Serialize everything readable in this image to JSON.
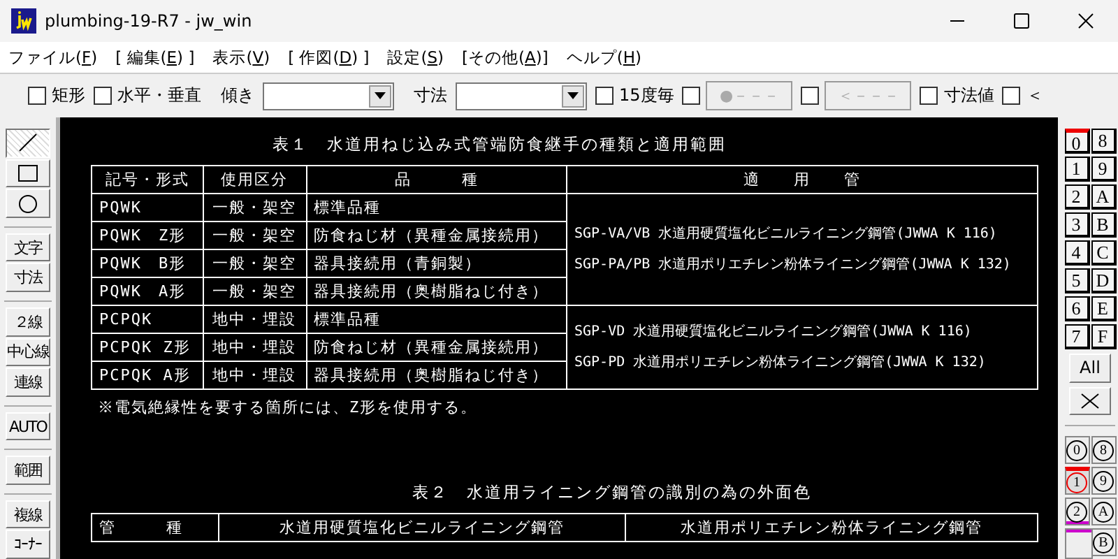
{
  "window": {
    "title": "plumbing-19-R7 - jw_win"
  },
  "menu": [
    {
      "before": "ファイル(",
      "key": "F",
      "after": ")"
    },
    {
      "before": "[ 編集(",
      "key": "E",
      "after": ") ]"
    },
    {
      "before": "表示(",
      "key": "V",
      "after": ")"
    },
    {
      "before": "[ 作図(",
      "key": "D",
      "after": ") ]"
    },
    {
      "before": "設定(",
      "key": "S",
      "after": ")"
    },
    {
      "before": "[その他(",
      "key": "A",
      "after": ")]"
    },
    {
      "before": "ヘルプ(",
      "key": "H",
      "after": ")"
    }
  ],
  "toolbar": [
    {
      "kind": "checkbox",
      "label": "矩形",
      "checked": false
    },
    {
      "kind": "checkbox",
      "label": "水平・垂直",
      "checked": false
    },
    {
      "kind": "label",
      "label": "傾き"
    },
    {
      "kind": "combo"
    },
    {
      "kind": "label",
      "label": "寸法"
    },
    {
      "kind": "combo"
    },
    {
      "kind": "checkbox",
      "label": "15度毎",
      "checked": false
    },
    {
      "kind": "check-button",
      "label": "●－－－",
      "checked": false
    },
    {
      "kind": "check-button",
      "label": "＜－－－",
      "checked": false
    },
    {
      "kind": "checkbox",
      "label": "寸法値",
      "checked": false
    },
    {
      "kind": "checkbox",
      "label": "＜",
      "checked": false
    }
  ],
  "tool_groups": [
    [
      {
        "kind": "line",
        "selected": true
      },
      {
        "kind": "rect",
        "selected": false
      },
      {
        "kind": "circle",
        "selected": false
      }
    ],
    [
      {
        "kind": "text",
        "label": "文字",
        "selected": false
      },
      {
        "kind": "text",
        "label": "寸法",
        "selected": false
      }
    ],
    [
      {
        "kind": "text",
        "label": "２線",
        "selected": false
      },
      {
        "kind": "text",
        "label": "中心線",
        "selected": false
      },
      {
        "kind": "text",
        "label": "連線",
        "selected": false
      }
    ],
    [
      {
        "kind": "text",
        "label": "AUTO",
        "selected": false
      }
    ],
    [
      {
        "kind": "text",
        "label": "範囲",
        "selected": false
      }
    ],
    [
      {
        "kind": "text",
        "label": "複線",
        "selected": false
      },
      {
        "kind": "text",
        "label": "ｺｰﾅｰ",
        "selected": false
      }
    ]
  ],
  "table1": {
    "title": "表１　水道用ねじ込み式管端防食継手の種類と適用範囲",
    "headers": [
      "記号・形式",
      "使用区分",
      "品　　　種",
      "適　　用　　管"
    ],
    "groups": [
      {
        "applicable": [
          "SGP-VA/VB 水道用硬質塩化ビニルライニング鋼管(JWWA K 116)",
          "SGP-PA/PB 水道用ポリエチレン粉体ライニング鋼管(JWWA K 132)"
        ],
        "rows": [
          [
            "PQWK",
            "一般・架空",
            "標準品種"
          ],
          [
            "PQWK　Z形",
            "一般・架空",
            "防食ねじ材（異種金属接続用）"
          ],
          [
            "PQWK　B形",
            "一般・架空",
            "器具接続用（青銅製）"
          ],
          [
            "PQWK　A形",
            "一般・架空",
            "器具接続用（奥樹脂ねじ付き）"
          ]
        ]
      },
      {
        "applicable": [
          "SGP-VD 水道用硬質塩化ビニルライニング鋼管(JWWA K 116)",
          "SGP-PD 水道用ポリエチレン粉体ライニング鋼管(JWWA K 132)"
        ],
        "rows": [
          [
            "PCPQK",
            "地中・埋設",
            "標準品種"
          ],
          [
            "PCPQK Z形",
            "地中・埋設",
            "防食ねじ材（異種金属接続用）"
          ],
          [
            "PCPQK A形",
            "地中・埋設",
            "器具接続用（奥樹脂ねじ付き）"
          ]
        ]
      }
    ],
    "note": "※電気絶縁性を要する箇所には、Z形を使用する。"
  },
  "table2": {
    "title": "表２　水道用ライニング鋼管の識別の為の外面色",
    "headers": [
      "管　　　種",
      "水道用硬質塩化ビニルライニング鋼管",
      "水道用ポリエチレン粉体ライニング鋼管"
    ]
  },
  "layers": [
    {
      "label": "0",
      "selected": true
    },
    {
      "label": "8",
      "selected": false
    },
    {
      "label": "1",
      "selected": false
    },
    {
      "label": "9",
      "selected": false
    },
    {
      "label": "2",
      "selected": false
    },
    {
      "label": "A",
      "selected": false
    },
    {
      "label": "3",
      "selected": false
    },
    {
      "label": "B",
      "selected": false
    },
    {
      "label": "4",
      "selected": false
    },
    {
      "label": "C",
      "selected": false
    },
    {
      "label": "5",
      "selected": false
    },
    {
      "label": "D",
      "selected": false
    },
    {
      "label": "6",
      "selected": false
    },
    {
      "label": "E",
      "selected": false
    },
    {
      "label": "7",
      "selected": false
    },
    {
      "label": "F",
      "selected": false
    }
  ],
  "all_button": "All",
  "layer_groups": [
    {
      "kind": "circle",
      "label": "0",
      "selected": false,
      "marked": false
    },
    {
      "kind": "circle",
      "label": "8",
      "selected": false,
      "marked": false
    },
    {
      "kind": "circle",
      "label": "1",
      "selected": true,
      "marked": false
    },
    {
      "kind": "circle",
      "label": "9",
      "selected": false,
      "marked": false
    },
    {
      "kind": "circle",
      "label": "2",
      "selected": false,
      "marked": true
    },
    {
      "kind": "circle",
      "label": "A",
      "selected": false,
      "marked": false
    },
    {
      "kind": "blank",
      "marked": true
    },
    {
      "kind": "circle",
      "label": "B",
      "selected": false,
      "marked": false
    }
  ]
}
